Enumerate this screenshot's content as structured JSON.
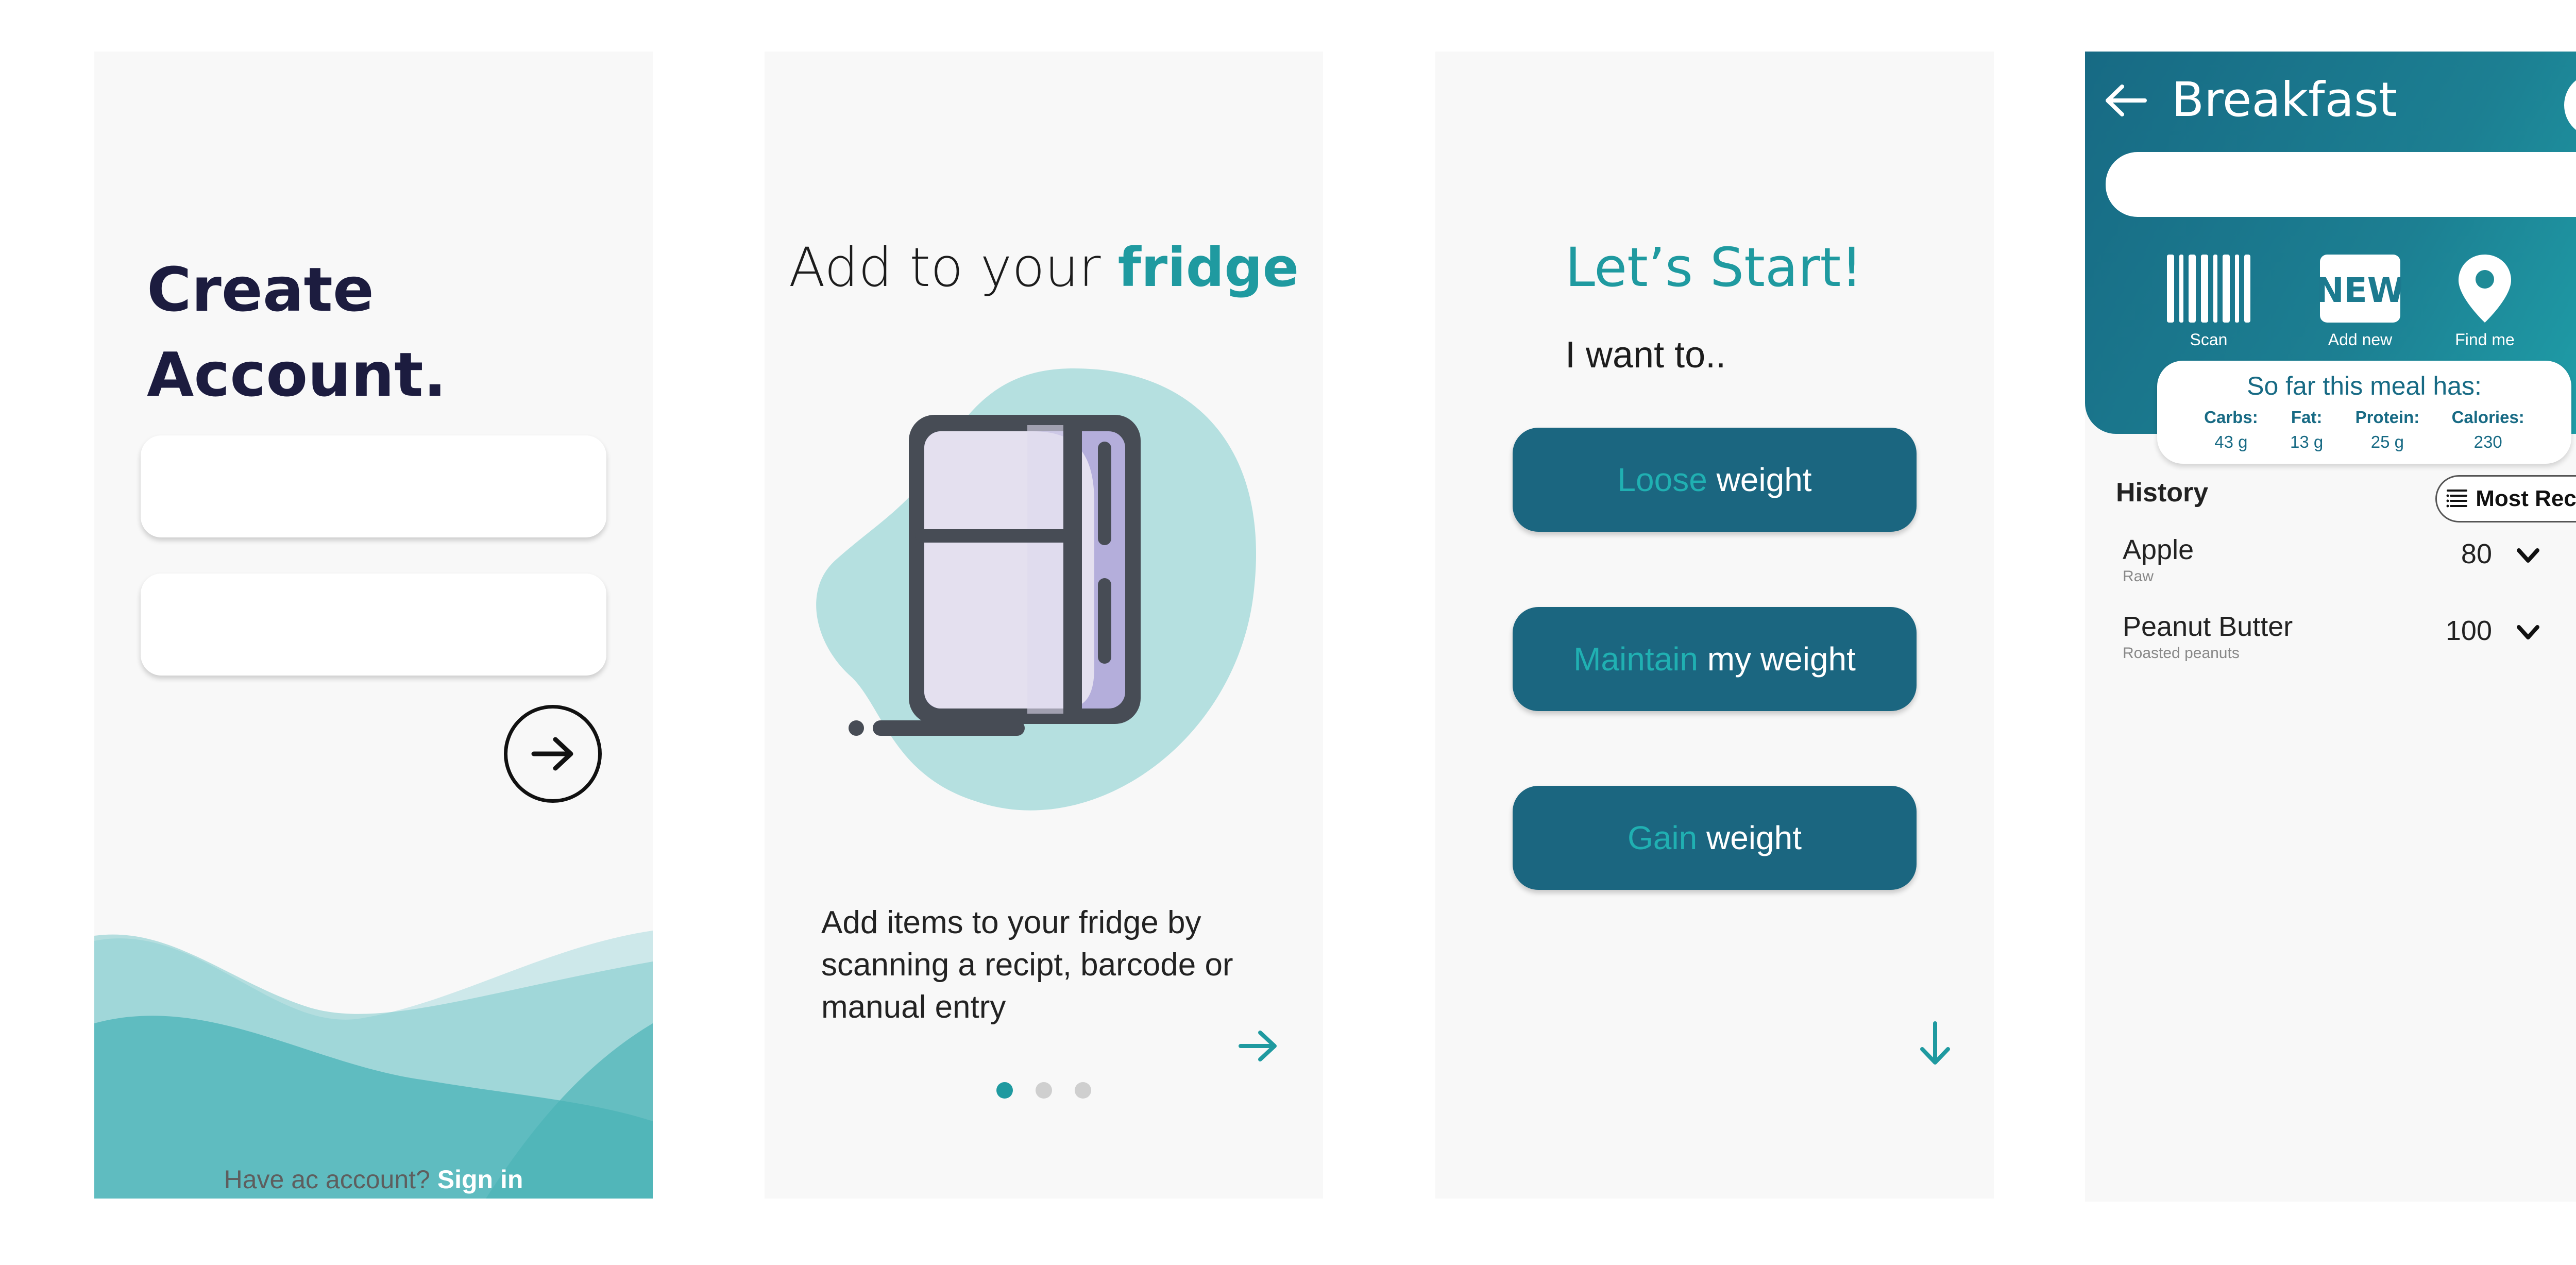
{
  "screen_signup": {
    "title_line1": "Create",
    "title_line2": "Account.",
    "footer_prefix": "Have ac account?",
    "footer_link": "Sign in"
  },
  "screen_fridge": {
    "title_plain": "Add to your",
    "title_highlight": "fridge",
    "description": "Add items to your fridge by scanning a recipt, barcode or manual entry",
    "pagination": {
      "total": 3,
      "active_index": 1
    }
  },
  "screen_goal": {
    "title": "Let’s Start!",
    "subtitle": "I want to..",
    "options": [
      {
        "highlight": "Loose",
        "rest": "weight"
      },
      {
        "highlight": "Maintain",
        "rest": "my weight"
      },
      {
        "highlight": "Gain",
        "rest": "weight"
      }
    ]
  },
  "screen_meal": {
    "title": "Breakfast",
    "search_placeholder": "",
    "actions": [
      {
        "label": "Scan",
        "icon": "barcode-icon"
      },
      {
        "label": "Add new",
        "icon": "new-badge-icon"
      },
      {
        "label": "Find me",
        "icon": "location-pin-icon"
      }
    ],
    "summary": {
      "title": "So far this meal has:",
      "macros": [
        {
          "label": "Carbs:",
          "value": "43 g"
        },
        {
          "label": "Fat:",
          "value": "13 g"
        },
        {
          "label": "Protein:",
          "value": "25 g"
        },
        {
          "label": "Calories:",
          "value": "230"
        }
      ]
    },
    "history_title": "History",
    "sort_label": "Most Recent",
    "items": [
      {
        "name": "Apple",
        "sub": "Raw",
        "qty": "80",
        "checked": true
      },
      {
        "name": "Peanut Butter",
        "sub": "Roasted peanuts",
        "qty": "100",
        "checked": false
      }
    ]
  },
  "colors": {
    "teal_dark": "#1b6680",
    "teal_accent": "#1f9aa0",
    "blob": "#b5e0e0",
    "fridge_outline": "#474c55",
    "fridge_body": "#e4e0ef",
    "fridge_shade": "#b4aedb"
  }
}
